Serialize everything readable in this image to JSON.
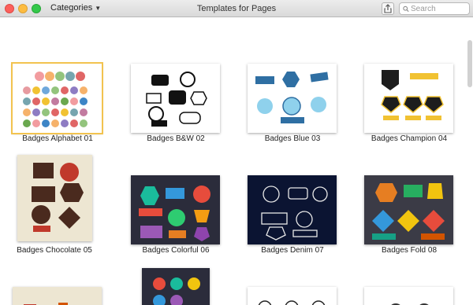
{
  "window": {
    "title": "Templates for Pages",
    "categories_label": "Categories",
    "search_placeholder": "Search"
  },
  "templates": [
    {
      "label": "Badges Alphabet 01"
    },
    {
      "label": "Badges B&W 02"
    },
    {
      "label": "Badges Blue 03"
    },
    {
      "label": "Badges Champion 04"
    },
    {
      "label": "Badges Chocolate 05"
    },
    {
      "label": "Badges Colorful 06"
    },
    {
      "label": "Badges Denim 07"
    },
    {
      "label": "Badges Fold 08"
    }
  ],
  "colors": {
    "selection": "#f2c34f",
    "close": "#fc605c",
    "minimize": "#fdbc40",
    "maximize": "#34c84a"
  }
}
